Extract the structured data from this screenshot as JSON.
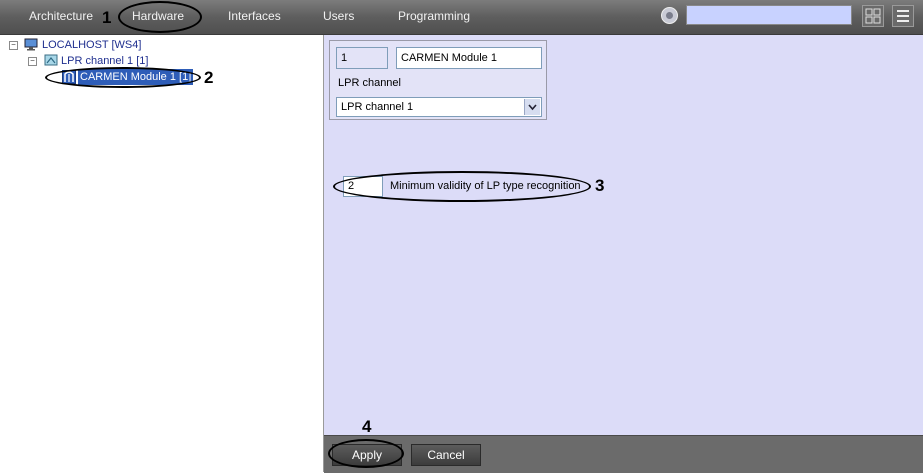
{
  "topbar": {
    "tabs": [
      {
        "label": "Architecture"
      },
      {
        "label": "Hardware"
      },
      {
        "label": "Interfaces"
      },
      {
        "label": "Users"
      },
      {
        "label": "Programming"
      }
    ],
    "search_value": ""
  },
  "tree": {
    "root": "LOCALHOST [WS4]",
    "channel": "LPR channel 1 [1]",
    "module": "CARMEN Module 1 [1]"
  },
  "settings": {
    "id_value": "1",
    "name_value": "CARMEN Module 1",
    "lpr_channel_label": "LPR channel",
    "lpr_channel_selected": "LPR channel 1",
    "validity_value": "2",
    "validity_label": "Minimum validity of LP type recognition"
  },
  "footer": {
    "apply_label": "Apply",
    "cancel_label": "Cancel"
  },
  "annotations": [
    "1",
    "2",
    "3",
    "4"
  ],
  "colors": {
    "panel_bg": "#dcdcf8",
    "selected_item": "#2e5db8",
    "search_field": "#c8d2ff"
  }
}
